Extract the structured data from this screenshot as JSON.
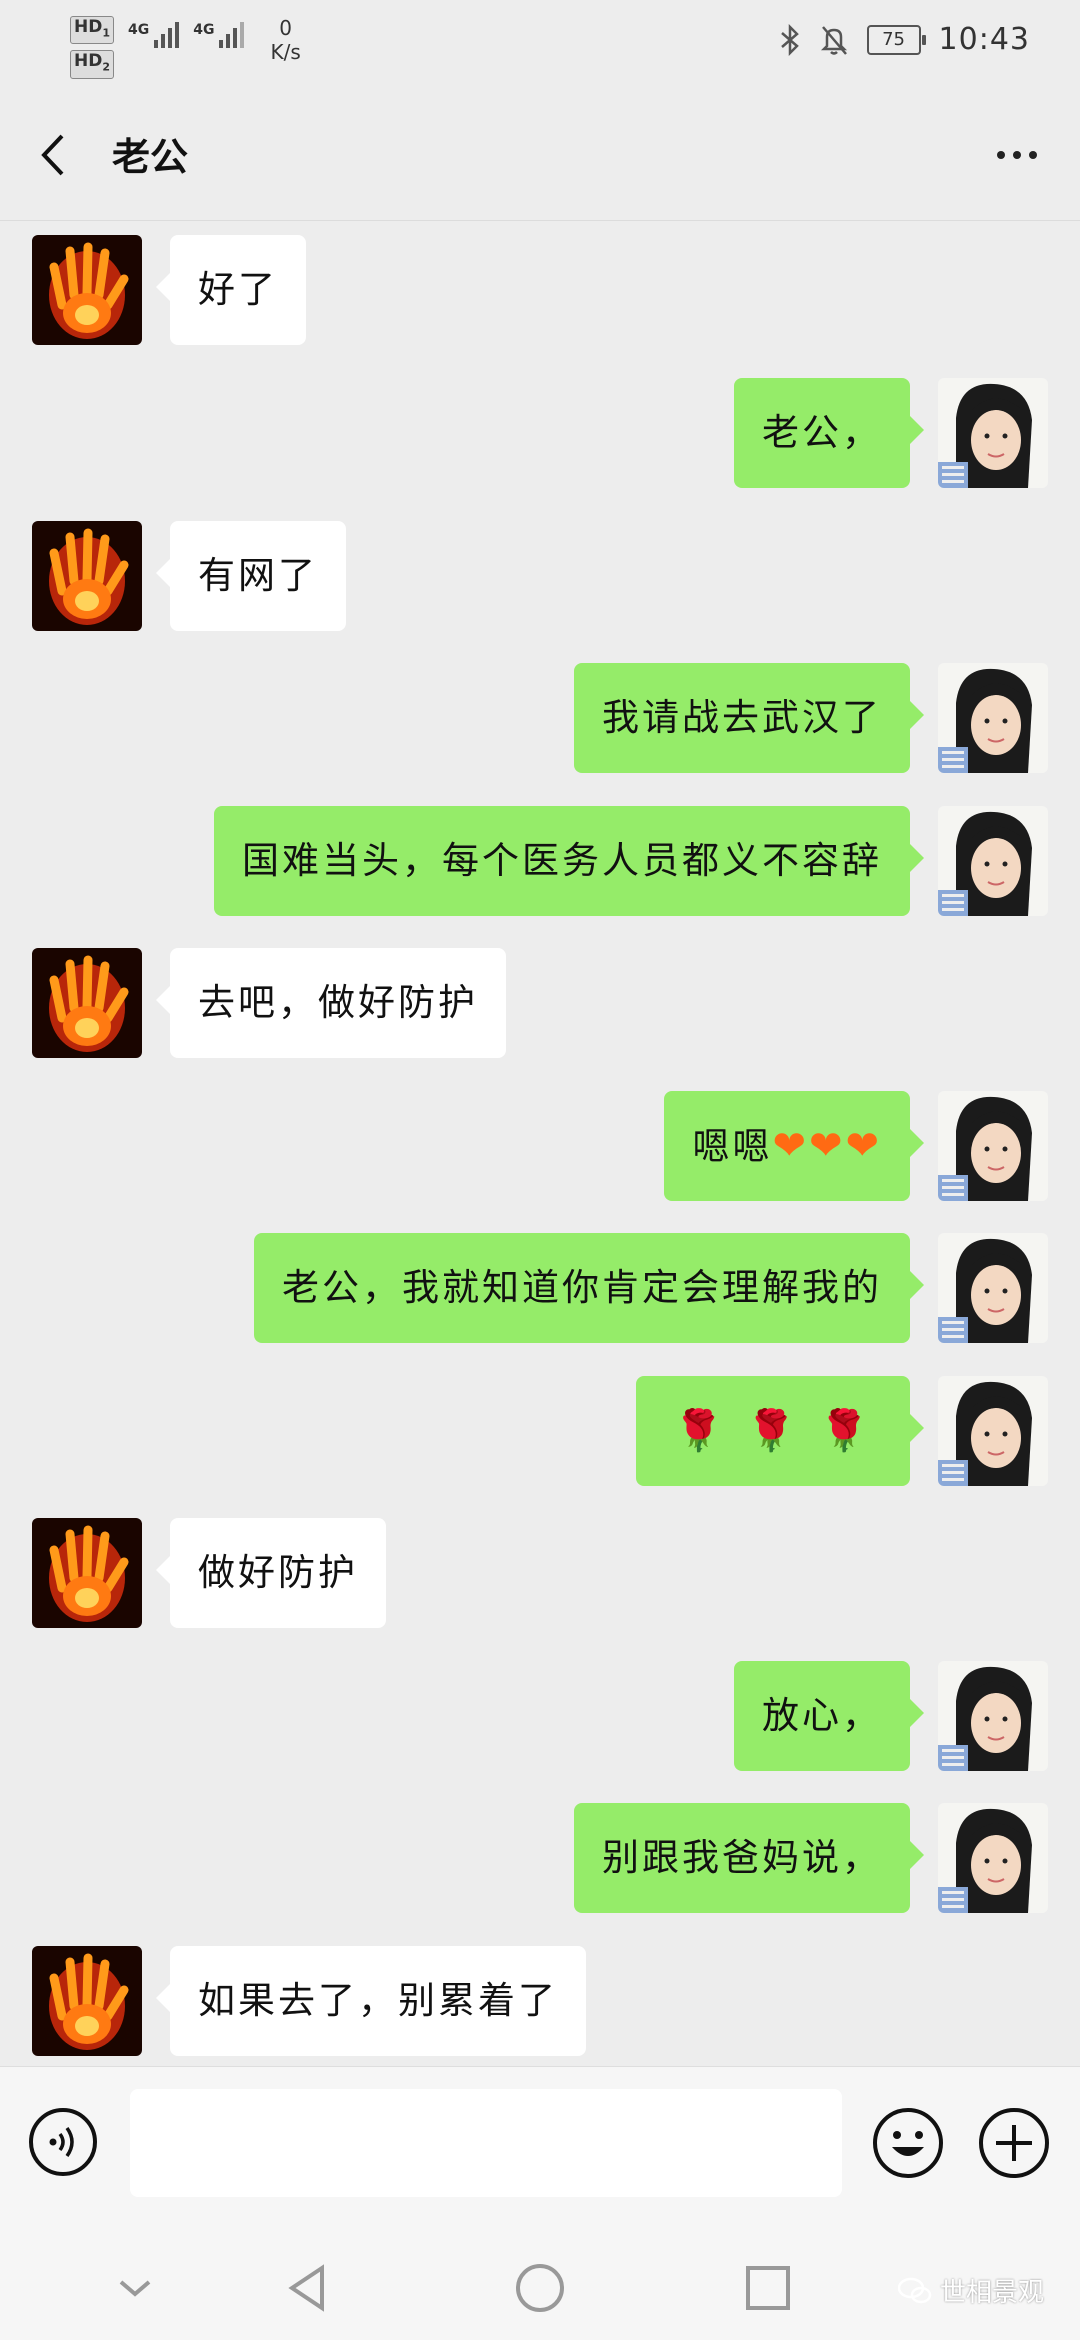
{
  "status_bar": {
    "sim1": "HD",
    "sim1_index": "1",
    "sim2": "HD",
    "sim2_index": "2",
    "network1": "4G",
    "network2": "4G",
    "speed_value": "0",
    "speed_unit": "K/s",
    "battery": "75",
    "time": "10:43"
  },
  "header": {
    "title": "老公"
  },
  "messages": [
    {
      "side": "left",
      "text": "好了"
    },
    {
      "side": "right",
      "text": "老公，"
    },
    {
      "side": "left",
      "text": "有网了"
    },
    {
      "side": "right",
      "text": "我请战去武汉了"
    },
    {
      "side": "right",
      "text": "国难当头，每个医务人员都义不容辞"
    },
    {
      "side": "left",
      "text": "去吧，做好防护"
    },
    {
      "side": "right",
      "text": "嗯嗯",
      "emoji": [
        "❤",
        "❤",
        "❤"
      ]
    },
    {
      "side": "right",
      "text": "老公，我就知道你肯定会理解我的"
    },
    {
      "side": "right",
      "text": "",
      "emoji": [
        "🌹",
        "🌹",
        "🌹"
      ]
    },
    {
      "side": "left",
      "text": "做好防护"
    },
    {
      "side": "right",
      "text": "放心，"
    },
    {
      "side": "right",
      "text": "别跟我爸妈说，"
    },
    {
      "side": "left",
      "text": "如果去了，别累着了"
    }
  ],
  "input": {
    "placeholder": ""
  },
  "watermark": "世相景观",
  "colors": {
    "background": "#ededed",
    "outgoing_bubble": "#95ec69",
    "incoming_bubble": "#ffffff"
  }
}
